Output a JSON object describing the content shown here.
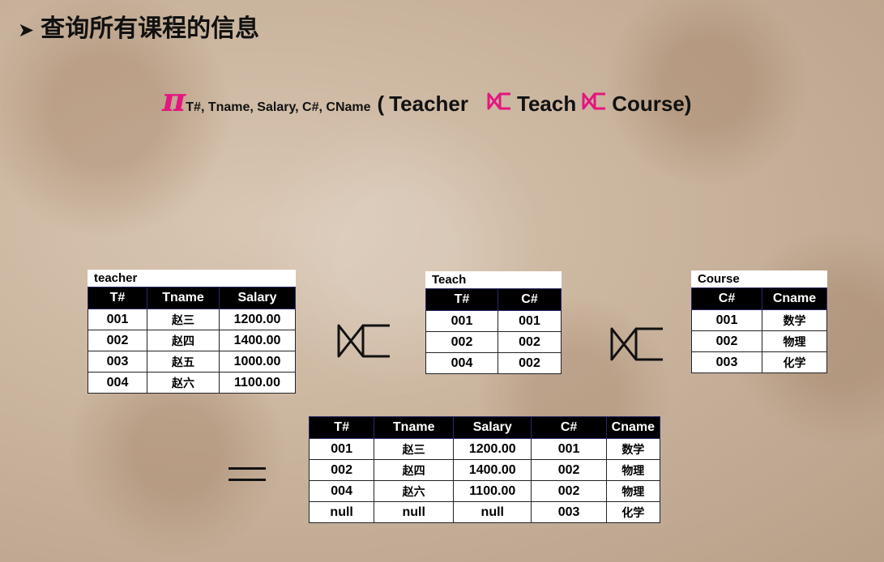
{
  "heading": "查询所有课程的信息",
  "heading_bullet": "➤",
  "formula": {
    "pi": "π",
    "projection": "T#, Tname, Salary, C#, CName",
    "open": "(",
    "rel1": "Teacher",
    "rel2": "Teach",
    "rel3": "Course)"
  },
  "colors": {
    "pi": "#e4167f",
    "header_bg": "#000000"
  },
  "teacher": {
    "caption": "teacher",
    "headers": [
      "T#",
      "Tname",
      "Salary"
    ],
    "rows": [
      [
        "001",
        "赵三",
        "1200.00"
      ],
      [
        "002",
        "赵四",
        "1400.00"
      ],
      [
        "003",
        "赵五",
        "1000.00"
      ],
      [
        "004",
        "赵六",
        "1100.00"
      ]
    ]
  },
  "teach": {
    "caption": "Teach",
    "headers": [
      "T#",
      "C#"
    ],
    "rows": [
      [
        "001",
        "001"
      ],
      [
        "002",
        "002"
      ],
      [
        "004",
        "002"
      ]
    ]
  },
  "course": {
    "caption": "Course",
    "headers": [
      "C#",
      "Cname"
    ],
    "rows": [
      [
        "001",
        "数学"
      ],
      [
        "002",
        "物理"
      ],
      [
        "003",
        "化学"
      ]
    ]
  },
  "result": {
    "headers": [
      "T#",
      "Tname",
      "Salary",
      "C#",
      "Cname"
    ],
    "rows": [
      [
        "001",
        "赵三",
        "1200.00",
        "001",
        "数学"
      ],
      [
        "002",
        "赵四",
        "1400.00",
        "002",
        "物理"
      ],
      [
        "004",
        "赵六",
        "1100.00",
        "002",
        "物理"
      ],
      [
        "null",
        "null",
        "null",
        "003",
        "化学"
      ]
    ]
  }
}
